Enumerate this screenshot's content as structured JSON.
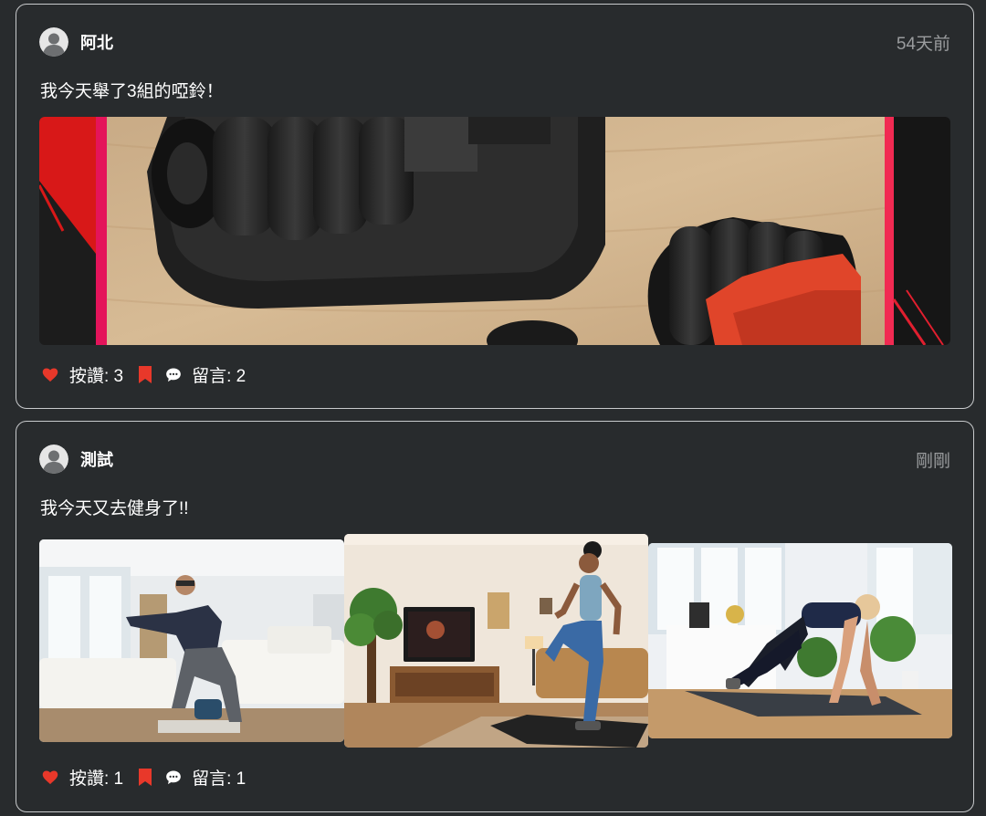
{
  "posts": [
    {
      "username": "阿北",
      "time": "54天前",
      "text": "我今天舉了3組的啞鈴！",
      "likes_text": "按讚: 3",
      "comments_text": "留言: 2"
    },
    {
      "username": "測試",
      "time": "剛剛",
      "text": "我今天又去健身了!!",
      "likes_text": "按讚: 1",
      "comments_text": "留言: 1"
    }
  ],
  "icons": {
    "like": "heart-icon",
    "save": "bookmark-icon",
    "comment": "chat-bubble-icon",
    "avatar": "user-avatar-icon"
  },
  "colors": {
    "background": "#282b2d",
    "border": "#c8cacc",
    "accent": "#e8382a",
    "muted": "#9a9c9e"
  }
}
